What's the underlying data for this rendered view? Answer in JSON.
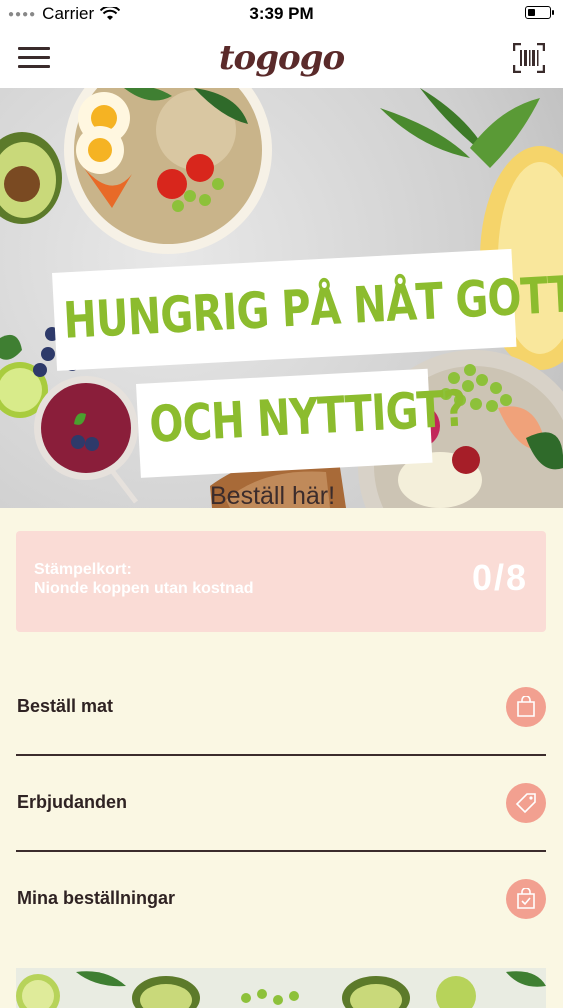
{
  "status_bar": {
    "carrier": "Carrier",
    "time": "3:39 PM",
    "battery_level": 0.35
  },
  "header": {
    "logo": "togogo",
    "menu_icon": "hamburger-icon",
    "scan_icon": "barcode-scanner-icon"
  },
  "hero": {
    "headline_line1": "HUNGRIG PÅ NÅT GOTT",
    "headline_line2": "OCH NYTTIGT?",
    "subtext": "Beställ här!"
  },
  "stamp_card": {
    "title": "Stämpelkort:",
    "subtitle": "Nionde koppen utan kostnad",
    "count": "0/8"
  },
  "menu": [
    {
      "label": "Beställ mat",
      "icon": "shopping-bag-icon"
    },
    {
      "label": "Erbjudanden",
      "icon": "tag-icon"
    },
    {
      "label": "Mina beställningar",
      "icon": "order-bag-check-icon"
    }
  ],
  "colors": {
    "accent": "#f2a090",
    "headline_green": "#8cbc2e",
    "background": "#faf7e3",
    "stamp_bg": "#fadcd6",
    "text_dark": "#2f2323"
  }
}
